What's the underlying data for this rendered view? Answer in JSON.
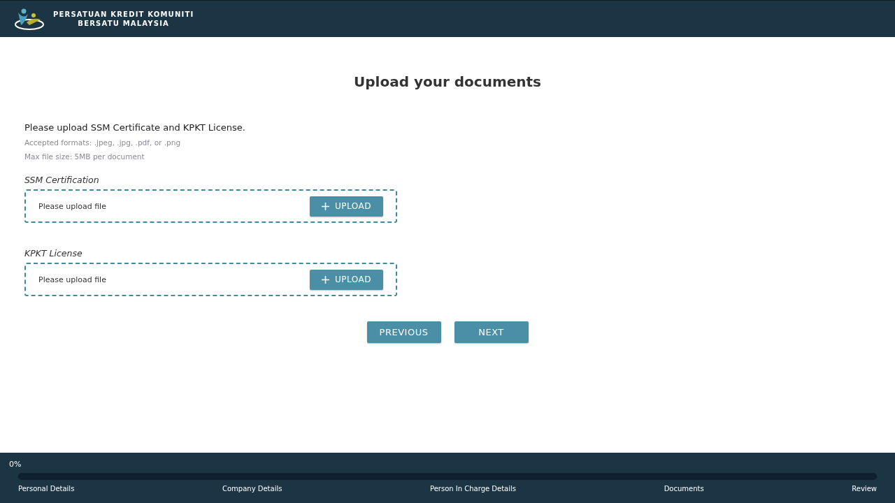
{
  "header": {
    "org_name_line1": "PERSATUAN KREDIT KOMUNITI",
    "org_name_line2": "BERSATU MALAYSIA"
  },
  "page_title": "Upload your documents",
  "instructions": {
    "main": "Please upload SSM Certificate and KPKT License.",
    "formats": "Accepted formats: .jpeg, .jpg, .pdf, or .png",
    "max_size": "Max file size: 5MB per document"
  },
  "uploads": [
    {
      "label": "SSM Certification",
      "status": "Please upload file",
      "button": "UPLOAD"
    },
    {
      "label": "KPKT License",
      "status": "Please upload file",
      "button": "UPLOAD"
    }
  ],
  "nav_buttons": [
    "PREVIOUS",
    "NEXT"
  ],
  "progress": {
    "percent": "0%",
    "level": 0,
    "steps": [
      "Personal Details",
      "Company Details",
      "Person In Charge Details",
      "Documents",
      "Review"
    ]
  }
}
